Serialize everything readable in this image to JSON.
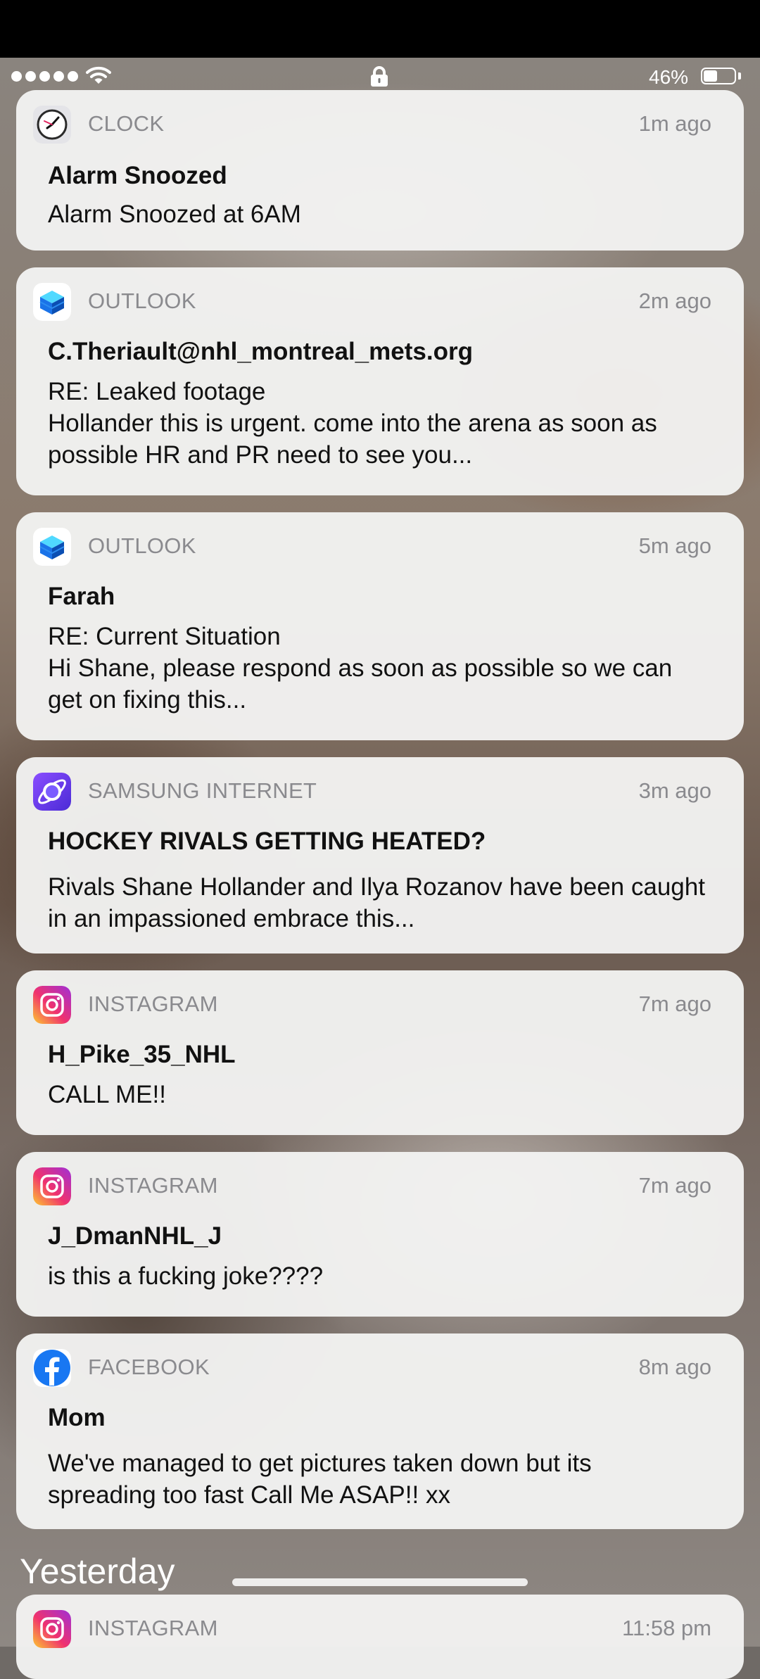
{
  "status_bar": {
    "battery_percent": "46%",
    "battery_level": 0.46,
    "signal_bars": 5
  },
  "notifications": [
    {
      "app": "CLOCK",
      "app_icon": "clock-icon",
      "time": "1m ago",
      "title": "Alarm Snoozed",
      "body": [
        "Alarm Snoozed at 6AM"
      ]
    },
    {
      "app": "OUTLOOK",
      "app_icon": "outlook-icon",
      "time": "2m ago",
      "title": "C.Theriault@nhl_montreal_mets.org",
      "body": [
        "RE: Leaked footage",
        "Hollander this is urgent. come into the arena as soon as",
        "possible HR and PR need to see you..."
      ]
    },
    {
      "app": "OUTLOOK",
      "app_icon": "outlook-icon",
      "time": "5m ago",
      "title": "Farah",
      "body": [
        "RE: Current Situation",
        "Hi Shane, please respond as soon as possible so we can",
        "get on fixing this..."
      ]
    },
    {
      "app": "SAMSUNG INTERNET",
      "app_icon": "samsung-internet-icon",
      "time": "3m ago",
      "title": "HOCKEY RIVALS GETTING HEATED?",
      "body": [
        "Rivals Shane Hollander and Ilya Rozanov have been caught",
        "in an impassioned embrace this..."
      ]
    },
    {
      "app": "INSTAGRAM",
      "app_icon": "instagram-icon",
      "time": "7m ago",
      "title": "H_Pike_35_NHL",
      "body": [
        "CALL ME!!"
      ]
    },
    {
      "app": "INSTAGRAM",
      "app_icon": "instagram-icon",
      "time": "7m ago",
      "title": "J_DmanNHL_J",
      "body": [
        "is this a fucking joke????"
      ]
    },
    {
      "app": "FACEBOOK",
      "app_icon": "facebook-icon",
      "time": "8m ago",
      "title": "Mom",
      "body": [
        "We've managed to get pictures taken down but its",
        "spreading too fast Call Me ASAP!! xx"
      ]
    }
  ],
  "section_header": "Yesterday",
  "partial_notification": {
    "app": "INSTAGRAM",
    "app_icon": "instagram-icon",
    "time": "11:58 pm"
  }
}
